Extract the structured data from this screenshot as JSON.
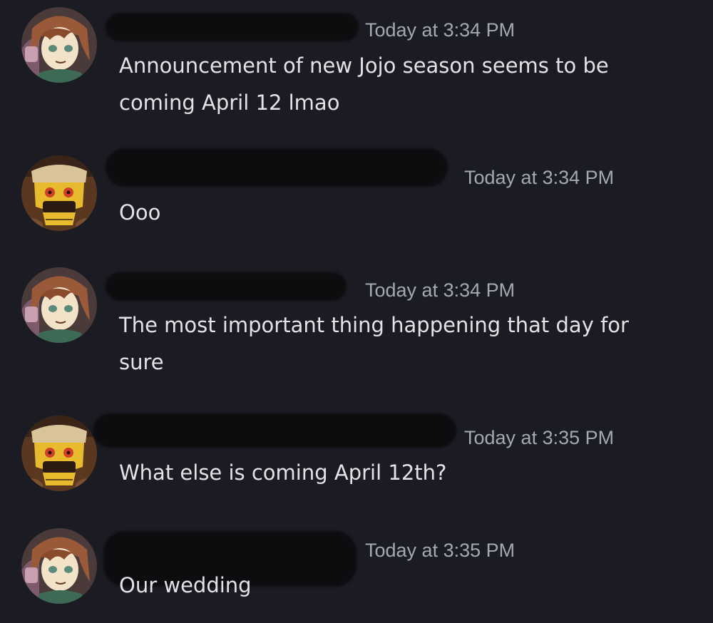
{
  "messages": [
    {
      "avatar": "girl-avatar",
      "timestamp": "Today at 3:34 PM",
      "text": "Announcement of new Jojo season seems to be coming April 12 lmao"
    },
    {
      "avatar": "robot-avatar",
      "timestamp": "Today at 3:34 PM",
      "text": "Ooo"
    },
    {
      "avatar": "girl-avatar",
      "timestamp": "Today at 3:34 PM",
      "text": "The most important thing happening that day for sure"
    },
    {
      "avatar": "robot-avatar",
      "timestamp": "Today at 3:35 PM",
      "text": "What else is coming April 12th?"
    },
    {
      "avatar": "girl-avatar",
      "timestamp": "Today at 3:35 PM",
      "text": "Our wedding"
    }
  ],
  "colors": {
    "background": "#1b1c23",
    "timestamp": "#a6a8b0",
    "message_text": "#e2e3e6",
    "redaction": "#0d0d10"
  }
}
